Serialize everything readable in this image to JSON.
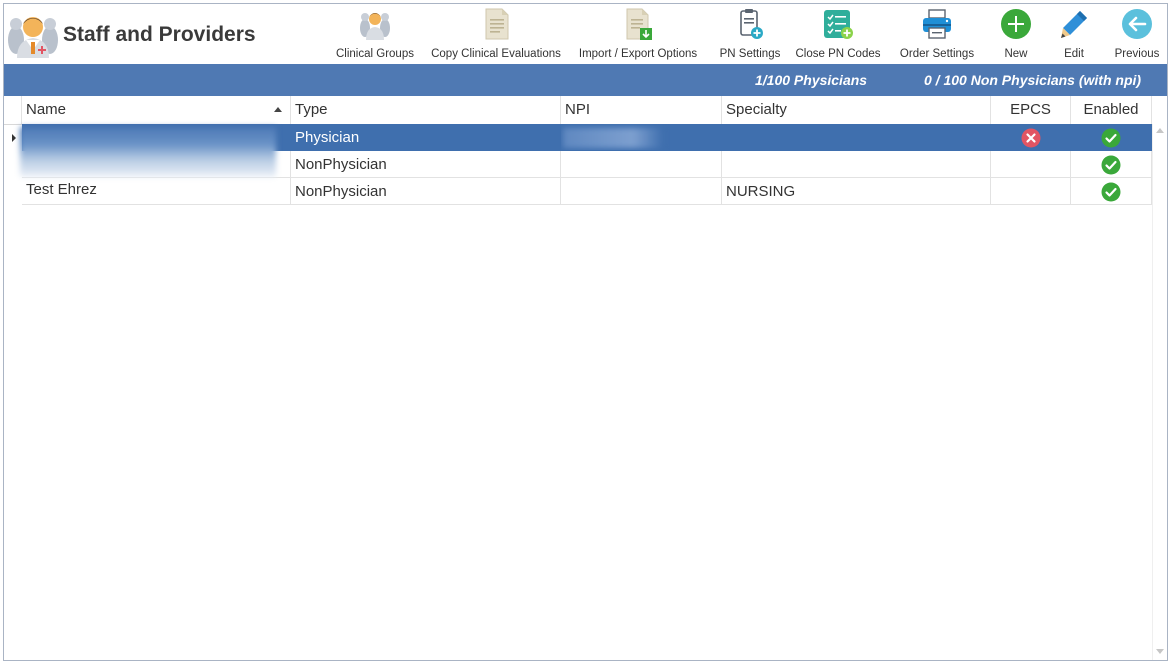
{
  "header": {
    "title": "Staff and Providers"
  },
  "toolbar": {
    "clinical_groups": "Clinical Groups",
    "copy_clinical_evaluations": "Copy Clinical Evaluations",
    "import_export_options": "Import / Export Options",
    "pn_settings": "PN Settings",
    "close_pn_codes": "Close PN Codes",
    "order_settings": "Order Settings",
    "new": "New",
    "edit": "Edit",
    "previous": "Previous"
  },
  "status": {
    "physicians": "1/100 Physicians",
    "non_physicians": "0 / 100 Non Physicians (with npi)"
  },
  "grid": {
    "columns": {
      "name": "Name",
      "type": "Type",
      "npi": "NPI",
      "specialty": "Specialty",
      "epcs": "EPCS",
      "enabled": "Enabled"
    },
    "sort_column": "Name",
    "sort_direction": "ascending",
    "rows": [
      {
        "name": "",
        "type": "Physician",
        "npi": "",
        "specialty": "",
        "epcs": "disabled-x-icon",
        "enabled": "enabled-check-icon",
        "selected": true
      },
      {
        "name": "",
        "type": "NonPhysician",
        "npi": "",
        "specialty": "",
        "epcs": "",
        "enabled": "enabled-check-icon",
        "selected": false
      },
      {
        "name": "Test Ehrez",
        "type": "NonPhysician",
        "npi": "",
        "specialty": "NURSING",
        "epcs": "",
        "enabled": "enabled-check-icon",
        "selected": false
      }
    ]
  },
  "colors": {
    "accent": "#4f79b3",
    "selection": "#3f6fae",
    "success": "#3aa83a",
    "danger": "#e25563"
  }
}
